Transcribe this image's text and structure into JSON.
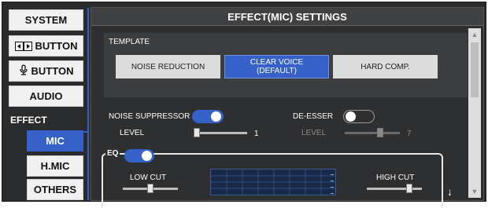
{
  "sidebar": {
    "system": "SYSTEM",
    "arrow_button": "BUTTON",
    "mic_button": "BUTTON",
    "audio": "AUDIO",
    "effect_label": "EFFECT",
    "mic": "MIC",
    "hmic": "H.MIC",
    "others": "OTHERS"
  },
  "main": {
    "title": "EFFECT(MIC) SETTINGS",
    "template": {
      "label": "TEMPLATE",
      "noise_reduction": "NOISE REDUCTION",
      "clear_voice_line1": "CLEAR VOICE",
      "clear_voice_line2": "(DEFAULT)",
      "hard_comp": "HARD COMP."
    },
    "noise_suppressor": {
      "label": "NOISE SUPPRESSOR",
      "level_label": "LEVEL",
      "level_value": "1",
      "enabled": true
    },
    "de_esser": {
      "label": "DE-ESSER",
      "level_label": "LEVEL",
      "level_value": "7",
      "enabled": false
    },
    "eq": {
      "label": "EQ",
      "enabled": true,
      "low_cut": "LOW CUT",
      "high_cut": "HIGH CUT"
    }
  },
  "colors": {
    "accent": "#3561c9",
    "background": "#2e2f31"
  }
}
